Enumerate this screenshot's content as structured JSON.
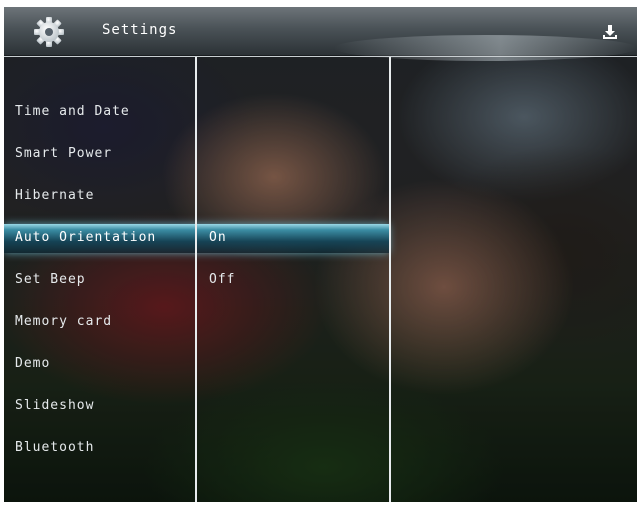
{
  "header": {
    "title": "Settings",
    "settings_icon": "gear-icon",
    "action_icon": "download-icon"
  },
  "menu": {
    "items": [
      {
        "label": "Time and Date"
      },
      {
        "label": "Smart Power"
      },
      {
        "label": "Hibernate"
      },
      {
        "label": "Auto Orientation",
        "selected": true
      },
      {
        "label": "Set Beep"
      },
      {
        "label": "Memory card"
      },
      {
        "label": "Demo"
      },
      {
        "label": "Slideshow"
      },
      {
        "label": "Bluetooth"
      }
    ]
  },
  "options": {
    "items": [
      {
        "label": "On",
        "selected": true
      },
      {
        "label": "Off"
      }
    ]
  },
  "colors": {
    "highlight": "#3c96af",
    "text": "#e6eaec"
  }
}
